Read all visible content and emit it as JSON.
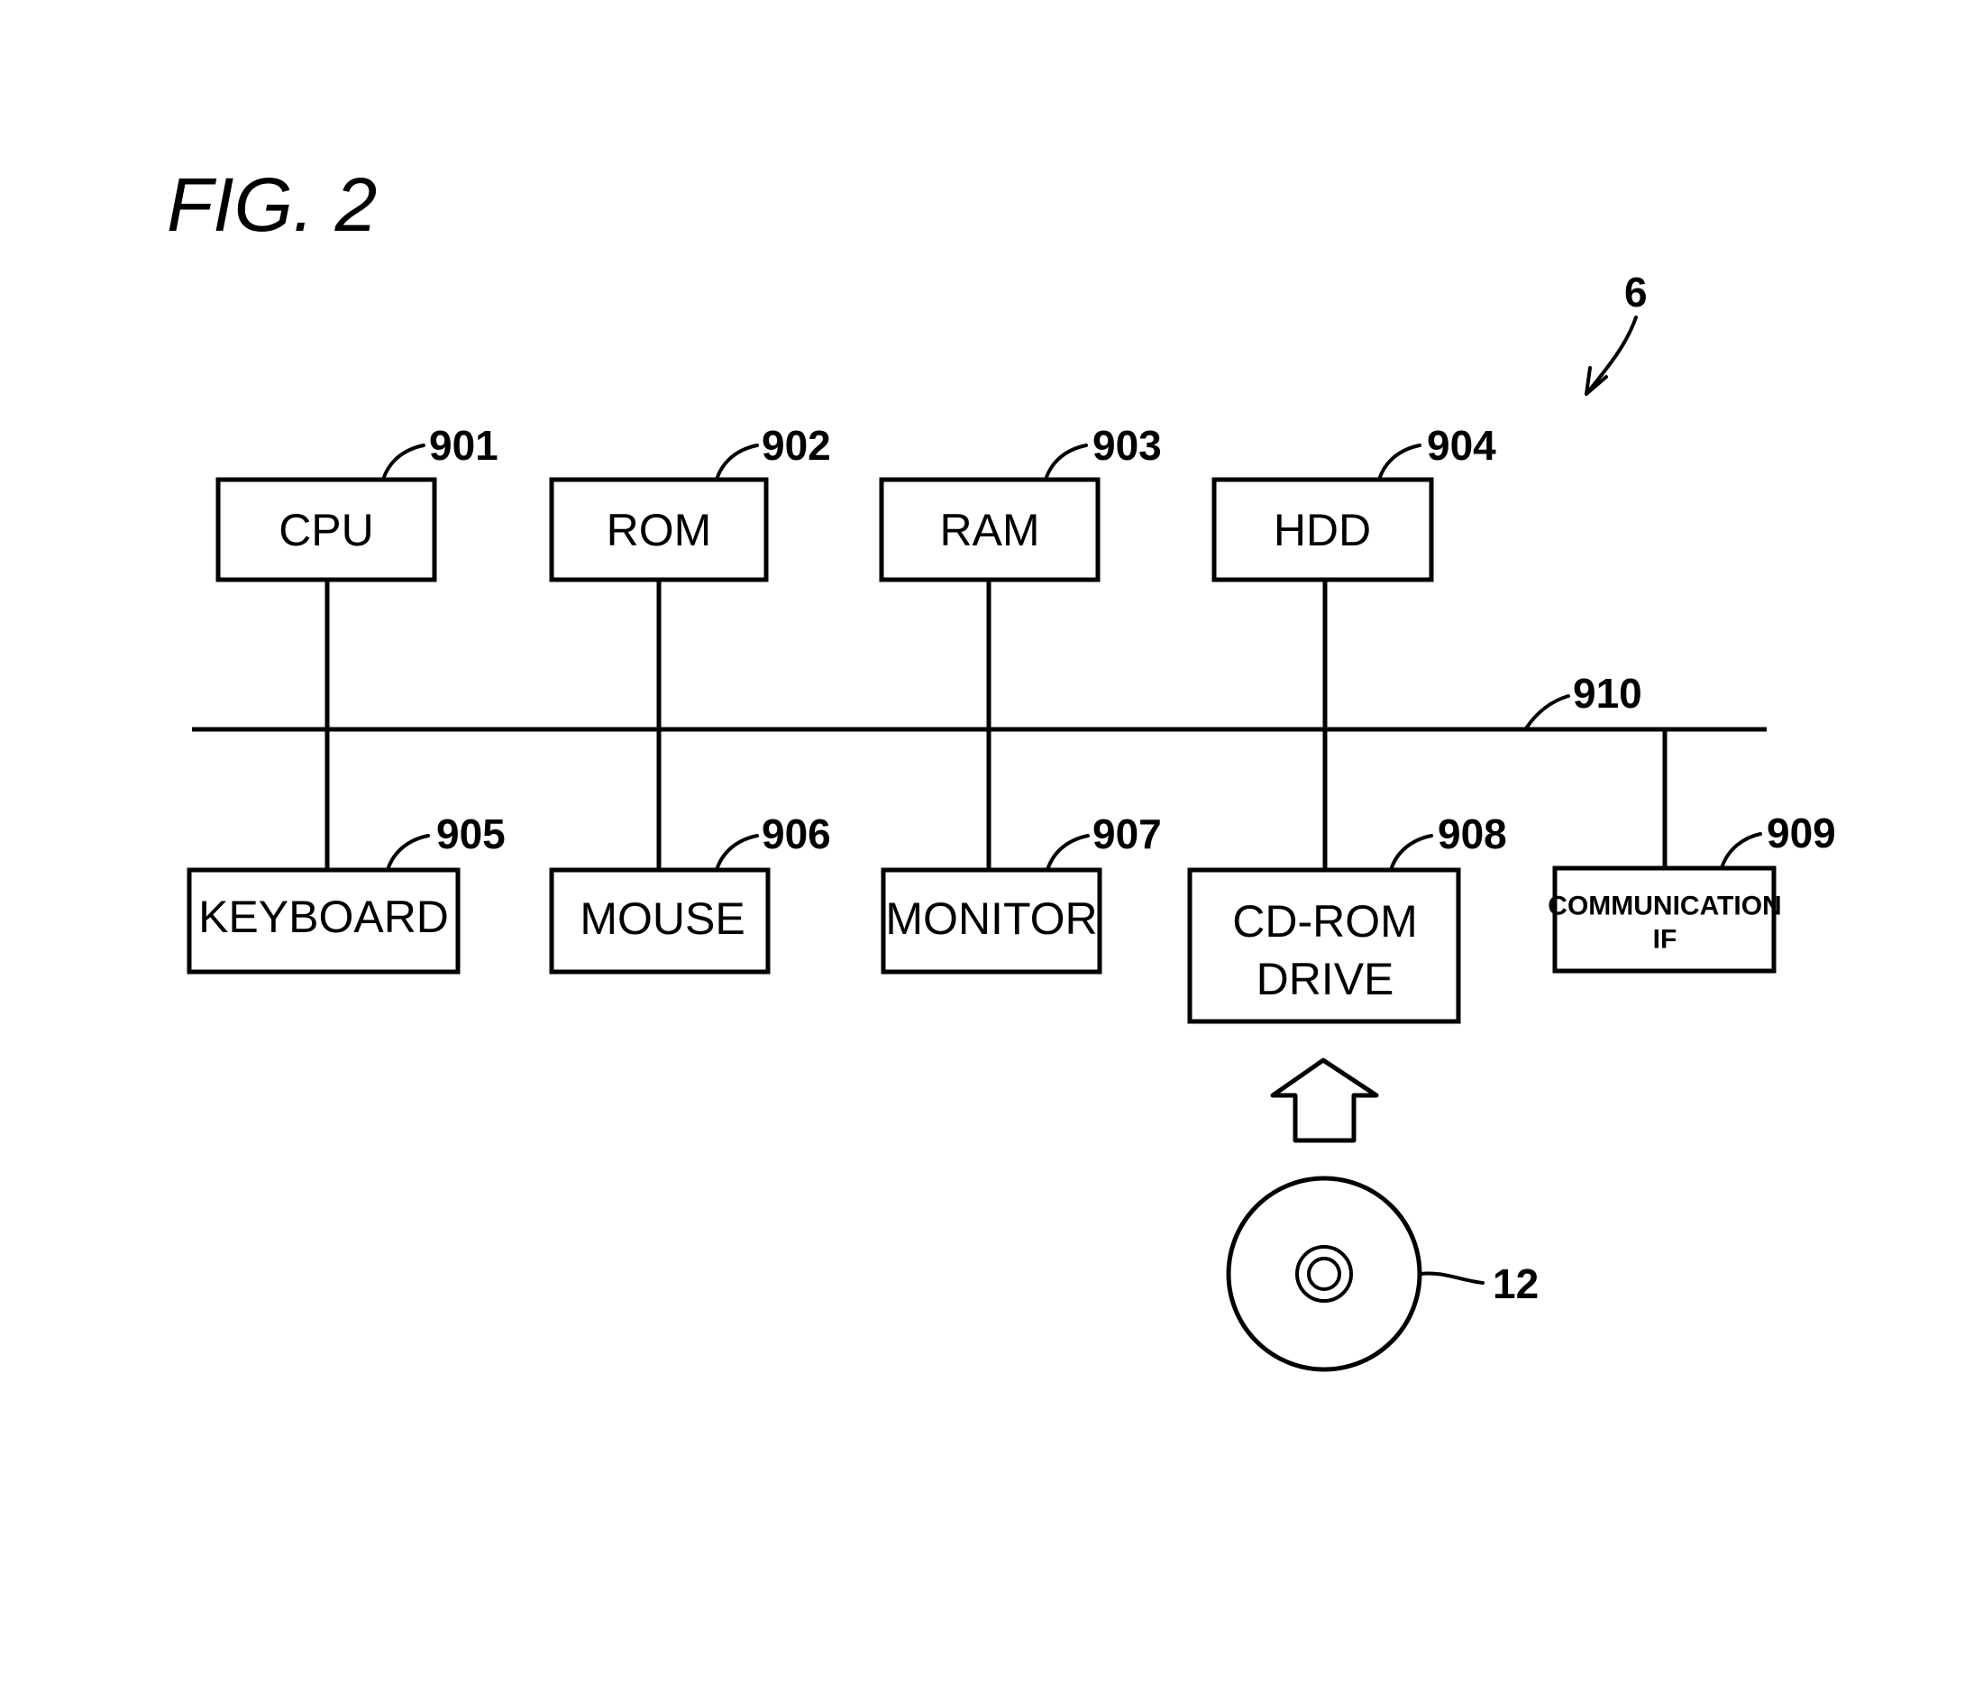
{
  "figure": {
    "title": "FIG. 2",
    "system_ref": "6",
    "bus_ref": "910",
    "upper_components": [
      {
        "id": "cpu",
        "label": "CPU",
        "ref": "901"
      },
      {
        "id": "rom",
        "label": "ROM",
        "ref": "902"
      },
      {
        "id": "ram",
        "label": "RAM",
        "ref": "903"
      },
      {
        "id": "hdd",
        "label": "HDD",
        "ref": "904"
      }
    ],
    "lower_components": [
      {
        "id": "keyboard",
        "label": "KEYBOARD",
        "ref": "905"
      },
      {
        "id": "mouse",
        "label": "MOUSE",
        "ref": "906"
      },
      {
        "id": "monitor",
        "label": "MONITOR",
        "ref": "907"
      },
      {
        "id": "cdrom",
        "label_lines": [
          "CD-ROM",
          "DRIVE"
        ],
        "ref": "908"
      },
      {
        "id": "comm",
        "label_lines": [
          "COMMUNICATION",
          "IF"
        ],
        "ref": "909"
      }
    ],
    "disc": {
      "label": "optical disc",
      "ref": "12"
    }
  }
}
